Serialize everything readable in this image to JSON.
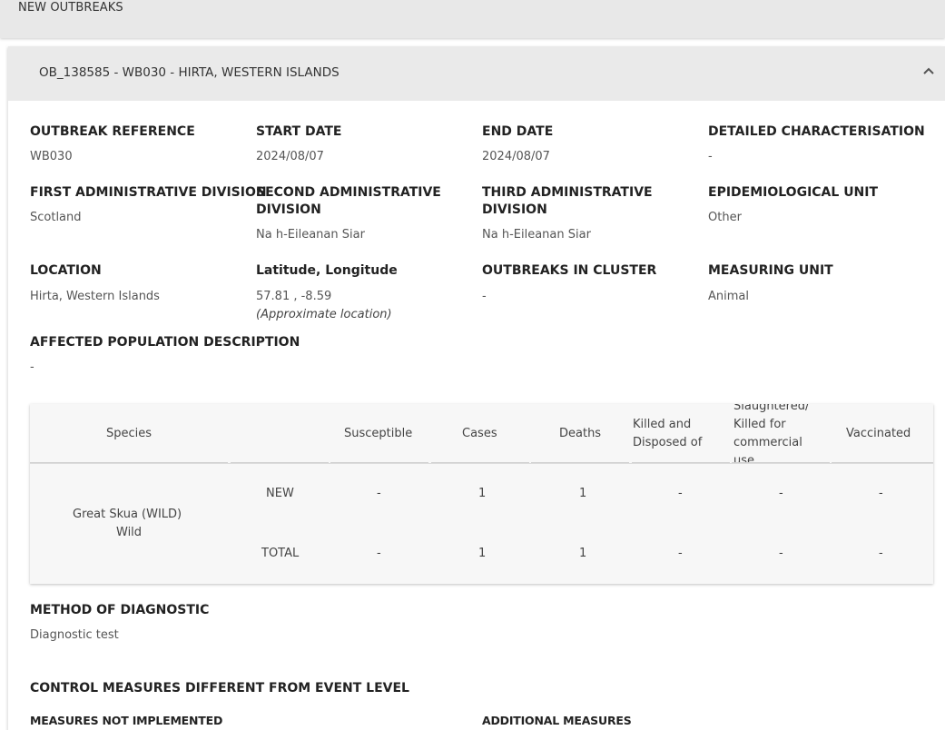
{
  "top_bar": {
    "title": "NEW OUTBREAKS"
  },
  "outbreak": {
    "header_title": "OB_138585 - WB030 - HIRTA, WESTERN ISLANDS",
    "fields": {
      "outbreak_reference": {
        "label": "OUTBREAK REFERENCE",
        "value": "WB030"
      },
      "start_date": {
        "label": "START DATE",
        "value": "2024/08/07"
      },
      "end_date": {
        "label": "END DATE",
        "value": "2024/08/07"
      },
      "detailed_characterisation": {
        "label": "DETAILED CHARACTERISATION",
        "value": "-"
      },
      "first_admin_division": {
        "label": "FIRST ADMINISTRATIVE DIVISION",
        "value": "Scotland"
      },
      "second_admin_division": {
        "label_line1": "SECOND ADMINISTRATIVE",
        "label_line2": "DIVISION",
        "value": "Na h-Eileanan Siar"
      },
      "third_admin_division": {
        "label_line1": "THIRD ADMINISTRATIVE",
        "label_line2": "DIVISION",
        "value": "Na h-Eileanan Siar"
      },
      "epidemiological_unit": {
        "label": "EPIDEMIOLOGICAL UNIT",
        "value": "Other"
      },
      "location": {
        "label": "LOCATION",
        "value": "Hirta, Western Islands"
      },
      "lat_long": {
        "label": "Latitude, Longitude",
        "value": "57.81 , -8.59",
        "note": "(Approximate location)"
      },
      "outbreaks_in_cluster": {
        "label": "OUTBREAKS IN CLUSTER",
        "value": "-"
      },
      "measuring_unit": {
        "label": "MEASURING UNIT",
        "value": "Animal"
      },
      "affected_population": {
        "label": "AFFECTED POPULATION DESCRIPTION",
        "value": "-"
      }
    },
    "table": {
      "headers": {
        "species": "Species",
        "susceptible": "Susceptible",
        "cases": "Cases",
        "deaths": "Deaths",
        "killed_line1": "Killed and",
        "killed_line2": "Disposed of",
        "slaughtered_line1": "Slaughtered/",
        "slaughtered_line2": "Killed for",
        "slaughtered_line3": "commercial",
        "slaughtered_line4": "use",
        "vaccinated": "Vaccinated"
      },
      "species_name": "Great Skua (WILD)",
      "species_type": "Wild",
      "rows": [
        {
          "label": "NEW",
          "susceptible": "-",
          "cases": "1",
          "deaths": "1",
          "killed": "-",
          "slaughtered": "-",
          "vaccinated": "-"
        },
        {
          "label": "TOTAL",
          "susceptible": "-",
          "cases": "1",
          "deaths": "1",
          "killed": "-",
          "slaughtered": "-",
          "vaccinated": "-"
        }
      ]
    },
    "method_of_diagnostic": {
      "label": "METHOD OF DIAGNOSTIC",
      "value": "Diagnostic test"
    },
    "control_measures": {
      "label": "CONTROL MEASURES DIFFERENT FROM EVENT LEVEL",
      "not_implemented_label": "MEASURES NOT IMPLEMENTED",
      "additional_label": "ADDITIONAL MEASURES"
    }
  }
}
